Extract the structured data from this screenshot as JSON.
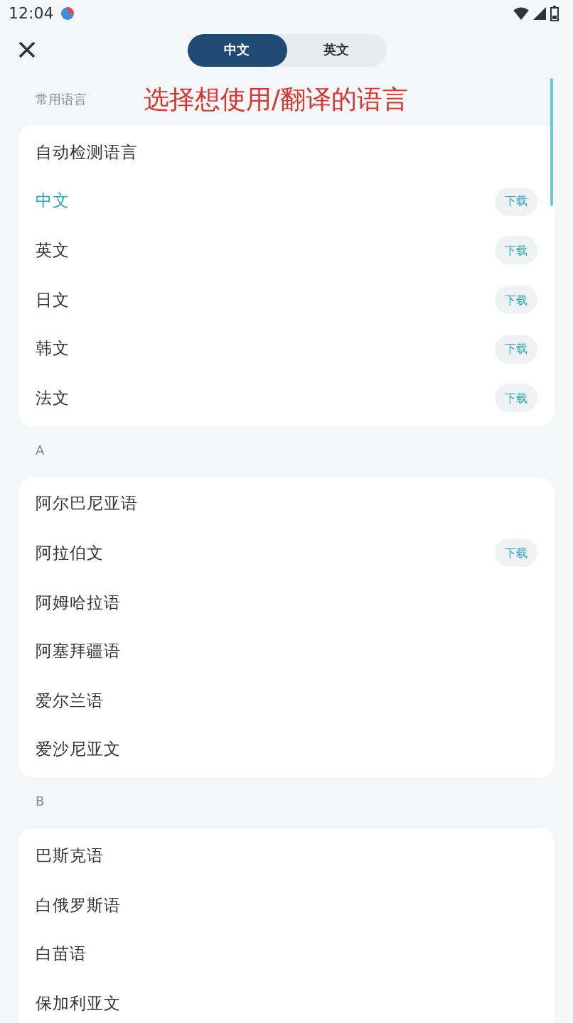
{
  "status_bar": {
    "time": "12:04"
  },
  "tabs": [
    {
      "label": "中文",
      "selected": true
    },
    {
      "label": "英文",
      "selected": false
    }
  ],
  "annotation": "选择想使用/翻译的语言",
  "sections": [
    {
      "title": "常用语言",
      "items": [
        {
          "name": "自动检测语言",
          "selected": false
        },
        {
          "name": "中文",
          "selected": true,
          "action": "下载"
        },
        {
          "name": "英文",
          "selected": false,
          "action": "下载"
        },
        {
          "name": "日文",
          "selected": false,
          "action": "下载"
        },
        {
          "name": "韩文",
          "selected": false,
          "action": "下载"
        },
        {
          "name": "法文",
          "selected": false,
          "action": "下载"
        }
      ]
    },
    {
      "title": "A",
      "items": [
        {
          "name": "阿尔巴尼亚语",
          "selected": false
        },
        {
          "name": "阿拉伯文",
          "selected": false,
          "action": "下载"
        },
        {
          "name": "阿姆哈拉语",
          "selected": false
        },
        {
          "name": "阿塞拜疆语",
          "selected": false
        },
        {
          "name": "爱尔兰语",
          "selected": false
        },
        {
          "name": "爱沙尼亚文",
          "selected": false
        }
      ]
    },
    {
      "title": "B",
      "items": [
        {
          "name": "巴斯克语",
          "selected": false
        },
        {
          "name": "白俄罗斯语",
          "selected": false
        },
        {
          "name": "白苗语",
          "selected": false
        },
        {
          "name": "保加利亚文",
          "selected": false
        }
      ]
    }
  ]
}
